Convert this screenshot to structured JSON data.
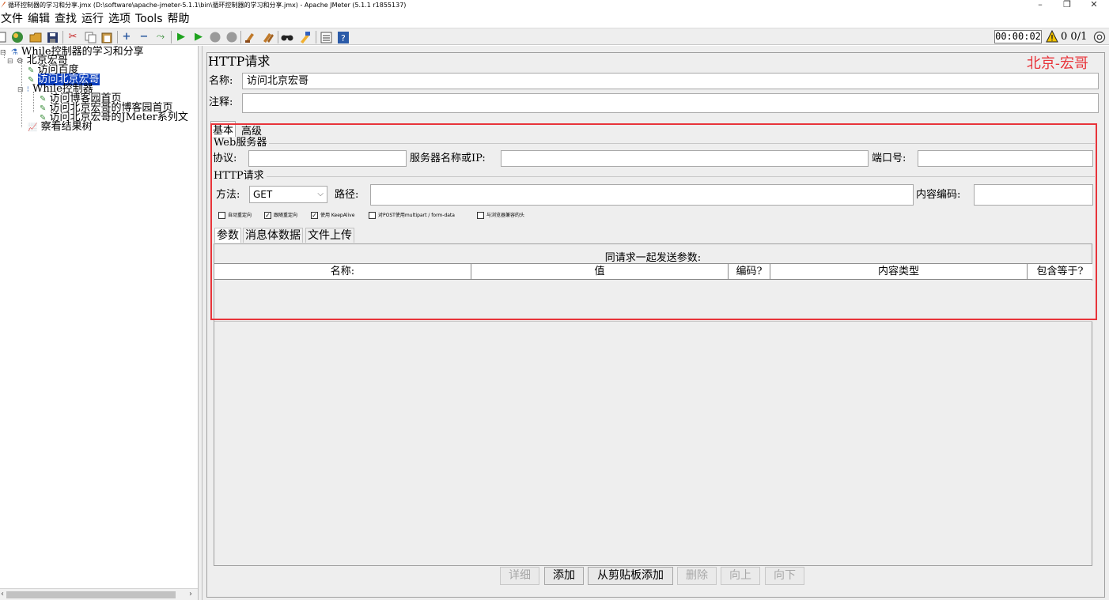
{
  "window": {
    "title": "循环控制器的学习和分享.jmx (D:\\software\\apache-jmeter-5.1.1\\bin\\循环控制器的学习和分享.jmx) - Apache JMeter (5.1.1 r1855137)",
    "minimize": "–",
    "restore": "❐",
    "close": "✕"
  },
  "menu": [
    "文件",
    "编辑",
    "查找",
    "运行",
    "选项",
    "Tools",
    "帮助"
  ],
  "toolbar": {
    "icons": [
      "new-icon",
      "templates-icon",
      "open-icon",
      "save-icon",
      "cut-icon",
      "copy-icon",
      "paste-icon",
      "expand-icon",
      "collapse-icon",
      "toggle-icon",
      "start-icon",
      "start-no-pause-icon",
      "stop-icon",
      "shutdown-icon",
      "clear-icon",
      "clear-all-icon",
      "search-icon",
      "reset-search-icon",
      "function-helper-icon",
      "help-icon"
    ],
    "timer": "00:00:02",
    "warn_count": "0",
    "threads": "0/1"
  },
  "tree": {
    "root": "While控制器的学习和分享",
    "thread_group": "北京宏哥",
    "sampler1": "访问百度",
    "sampler2_selected": "访问北京宏哥",
    "while_controller": "While控制器",
    "sampler3": "访问博客园首页",
    "sampler4": "访问北京宏哥的博客园首页",
    "sampler5": "访问北京宏哥的JMeter系列文",
    "listener": "察看结果树"
  },
  "panel": {
    "title": "HTTP请求",
    "watermark": "北京-宏哥",
    "name_label": "名称:",
    "name_value": "访问北京宏哥",
    "comment_label": "注释:",
    "comment_value": "",
    "tabs": [
      "基本",
      "高级"
    ],
    "web_server_title": "Web服务器",
    "protocol_label": "协议:",
    "protocol_value": "",
    "server_label": "服务器名称或IP:",
    "server_value": "",
    "port_label": "端口号:",
    "port_value": "",
    "http_request_title": "HTTP请求",
    "method_label": "方法:",
    "method_value": "GET",
    "path_label": "路径:",
    "path_value": "",
    "encoding_label": "内容编码:",
    "encoding_value": "",
    "checkboxes": [
      {
        "label": "自动重定向",
        "checked": false
      },
      {
        "label": "跟随重定向",
        "checked": true
      },
      {
        "label": "使用 KeepAlive",
        "checked": true
      },
      {
        "label": "对POST使用multipart / form-data",
        "checked": false
      },
      {
        "label": "与浏览器兼容的头",
        "checked": false
      }
    ],
    "subtabs": [
      "参数",
      "消息体数据",
      "文件上传"
    ],
    "params_caption": "同请求一起发送参数:",
    "columns": [
      "名称:",
      "值",
      "编码?",
      "内容类型",
      "包含等于?"
    ],
    "buttons": [
      {
        "label": "详细",
        "enabled": false
      },
      {
        "label": "添加",
        "enabled": true
      },
      {
        "label": "从剪贴板添加",
        "enabled": true
      },
      {
        "label": "删除",
        "enabled": false
      },
      {
        "label": "向上",
        "enabled": false
      },
      {
        "label": "向下",
        "enabled": false
      }
    ]
  },
  "colors": {
    "selection": "#0a3dbd",
    "highlight_box": "#e8343a",
    "watermark": "#e8343a"
  }
}
